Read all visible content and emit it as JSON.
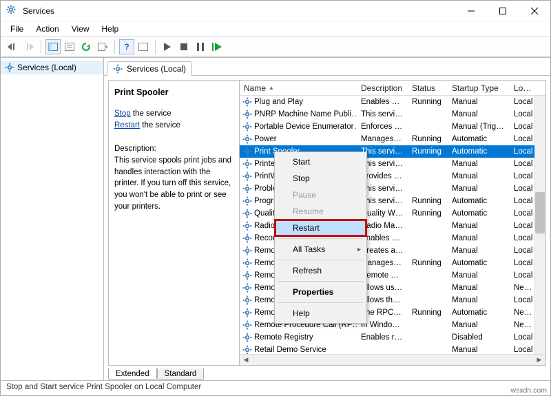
{
  "title": "Services",
  "menus": [
    "File",
    "Action",
    "View",
    "Help"
  ],
  "tree_root": "Services (Local)",
  "inner_header": "Services (Local)",
  "left": {
    "service_name": "Print Spooler",
    "stop_link": "Stop",
    "stop_tail": " the service",
    "restart_link": "Restart",
    "restart_tail": " the service",
    "desc_label": "Description:",
    "description": "This service spools print jobs and handles interaction with the printer. If you turn off this service, you won't be able to print or see your printers."
  },
  "columns": {
    "name": "Name",
    "desc": "Description",
    "status": "Status",
    "startup": "Startup Type",
    "logon": "Log O"
  },
  "rows": [
    {
      "n": "Plug and Play",
      "d": "Enables a c…",
      "s": "Running",
      "t": "Manual",
      "l": "Local"
    },
    {
      "n": "PNRP Machine Name Publi…",
      "d": "This service …",
      "s": "",
      "t": "Manual",
      "l": "Local"
    },
    {
      "n": "Portable Device Enumerator…",
      "d": "Enforces gr…",
      "s": "",
      "t": "Manual (Trig…",
      "l": "Local"
    },
    {
      "n": "Power",
      "d": "Manages p…",
      "s": "Running",
      "t": "Automatic",
      "l": "Local"
    },
    {
      "n": "Print Spooler",
      "d": "This service …",
      "s": "Running",
      "t": "Automatic",
      "l": "Local"
    },
    {
      "n": "Printer Extensions and Notif…",
      "d": "This service …",
      "s": "",
      "t": "Manual",
      "l": "Local"
    },
    {
      "n": "PrintWorkflow_2aef8",
      "d": "Provides su…",
      "s": "",
      "t": "Manual",
      "l": "Local"
    },
    {
      "n": "Problem Reports Control P…",
      "d": "This service …",
      "s": "",
      "t": "Manual",
      "l": "Local"
    },
    {
      "n": "Program Compatibility Assis…",
      "d": "This service …",
      "s": "Running",
      "t": "Automatic",
      "l": "Local"
    },
    {
      "n": "Quality Windows Audio Vid…",
      "d": "Quality Win…",
      "s": "Running",
      "t": "Automatic",
      "l": "Local"
    },
    {
      "n": "Radio Management Service",
      "d": "Radio Mana…",
      "s": "",
      "t": "Manual",
      "l": "Local"
    },
    {
      "n": "Recommended Troubleshoo…",
      "d": "Enables aut…",
      "s": "",
      "t": "Manual",
      "l": "Local"
    },
    {
      "n": "Remote Access Auto Conne…",
      "d": "Creates a co…",
      "s": "",
      "t": "Manual",
      "l": "Local"
    },
    {
      "n": "Remote Access Connection…",
      "d": "Manages di…",
      "s": "Running",
      "t": "Automatic",
      "l": "Local"
    },
    {
      "n": "Remote Desktop Configurat…",
      "d": "Remote Des…",
      "s": "",
      "t": "Manual",
      "l": "Local"
    },
    {
      "n": "Remote Desktop Services",
      "d": "Allows user…",
      "s": "",
      "t": "Manual",
      "l": "Netwo"
    },
    {
      "n": "Remote Desktop Services U…",
      "d": "Allows the r…",
      "s": "",
      "t": "Manual",
      "l": "Local"
    },
    {
      "n": "Remote Procedure Call (RPC)",
      "d": "The RPCSS s…",
      "s": "Running",
      "t": "Automatic",
      "l": "Netwo"
    },
    {
      "n": "Remote Procedure Call (RP…",
      "d": "In Windows…",
      "s": "",
      "t": "Manual",
      "l": "Netwo"
    },
    {
      "n": "Remote Registry",
      "d": "Enables rem…",
      "s": "",
      "t": "Disabled",
      "l": "Local"
    },
    {
      "n": "Retail Demo Service",
      "d": "",
      "s": "",
      "t": "Manual",
      "l": "Local"
    }
  ],
  "tabs": {
    "extended": "Extended",
    "standard": "Standard"
  },
  "statusbar": "Stop and Start service Print Spooler on Local Computer",
  "ctx": {
    "start": "Start",
    "stop": "Stop",
    "pause": "Pause",
    "resume": "Resume",
    "restart": "Restart",
    "alltasks": "All Tasks",
    "refresh": "Refresh",
    "properties": "Properties",
    "help": "Help"
  },
  "credit": "wsxdn.com"
}
